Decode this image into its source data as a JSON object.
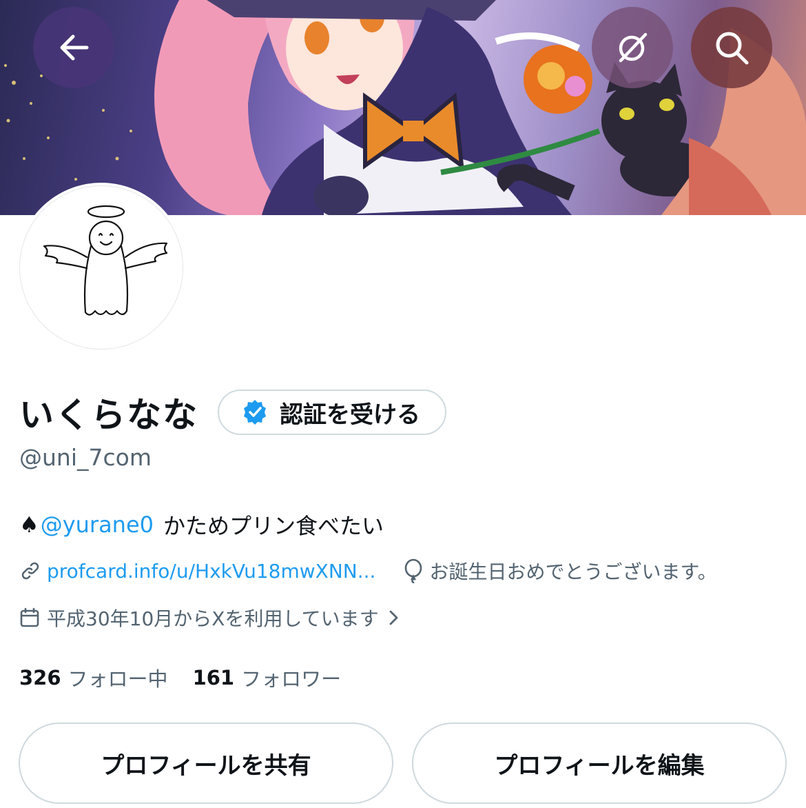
{
  "header": {
    "back_icon": "arrow-left-icon",
    "grok_icon": "grok-icon",
    "search_icon": "search-icon"
  },
  "profile": {
    "display_name": "いくらなな",
    "verify_label": "認証を受ける",
    "handle": "@uni_7com",
    "bio": {
      "prefix": "♠",
      "mention": "@yurane0",
      "text": "かためプリン食べたい"
    },
    "website": "profcard.info/u/HxkVu18mwXNN...",
    "location": "お誕生日おめでとうございます。",
    "joined": "平成30年10月からXを利用しています",
    "following_count": "326",
    "following_label": "フォロー中",
    "followers_count": "161",
    "followers_label": "フォロワー"
  },
  "actions": {
    "share_label": "プロフィールを共有",
    "edit_label": "プロフィールを編集"
  },
  "colors": {
    "accent": "#1d9bf0",
    "secondary_text": "#536471",
    "border": "#cfd9de"
  }
}
